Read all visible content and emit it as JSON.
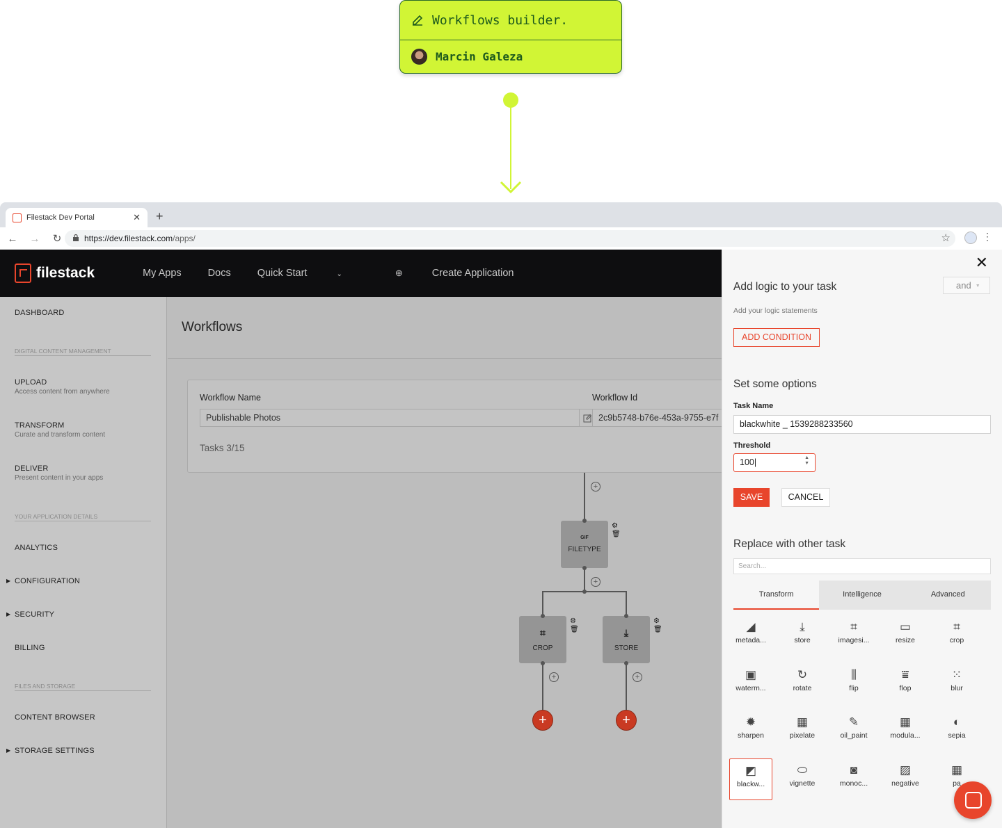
{
  "card": {
    "title": "Workflows builder.",
    "author": "Marcin Galeza",
    "accent": "#d1f535"
  },
  "browser": {
    "tab_title": "Filestack Dev Portal",
    "url_host": "https://dev.filestack.com",
    "url_path": "/apps/"
  },
  "nav": {
    "brand": "filestack",
    "links": [
      "My Apps",
      "Docs",
      "Quick Start",
      "Create Application"
    ]
  },
  "sidebar": {
    "dashboard": "DASHBOARD",
    "section_dcm": "DIGITAL CONTENT MANAGEMENT",
    "upload": "UPLOAD",
    "upload_sub": "Access content from anywhere",
    "transform": "TRANSFORM",
    "transform_sub": "Curate and transform content",
    "deliver": "DELIVER",
    "deliver_sub": "Present content in your apps",
    "section_app": "YOUR APPLICATION DETAILS",
    "analytics": "ANALYTICS",
    "configuration": "CONFIGURATION",
    "security": "SECURITY",
    "billing": "BILLING",
    "section_files": "FILES AND STORAGE",
    "content_browser": "CONTENT BROWSER",
    "storage_settings": "STORAGE SETTINGS"
  },
  "main": {
    "title": "Workflows",
    "workflow_name_label": "Workflow Name",
    "workflow_name_value": "Publishable Photos",
    "workflow_id_label": "Workflow Id",
    "workflow_id_value": "2c9b5748-b76e-453a-9755-e7f",
    "tasks": "Tasks 3/15",
    "nodes": {
      "filetype_icon": "GIF",
      "filetype": "FILETYPE",
      "crop": "CROP",
      "store": "STORE"
    }
  },
  "panel": {
    "logic_title": "Add logic to your task",
    "logic_select": "and",
    "logic_sub": "Add your logic statements",
    "add_condition": "ADD CONDITION",
    "options_title": "Set some options",
    "task_name_label": "Task Name",
    "task_name_value": "blackwhite _ 1539288233560",
    "threshold_label": "Threshold",
    "threshold_value": "100",
    "save": "SAVE",
    "cancel": "CANCEL",
    "replace_title": "Replace with other task",
    "search_placeholder": "Search...",
    "tabs": [
      "Transform",
      "Intelligence",
      "Advanced"
    ],
    "tasks": [
      {
        "label": "metada...",
        "icon": "metadata-icon"
      },
      {
        "label": "store",
        "icon": "store-icon"
      },
      {
        "label": "imagesi...",
        "icon": "imagesize-icon"
      },
      {
        "label": "resize",
        "icon": "resize-icon"
      },
      {
        "label": "crop",
        "icon": "crop-icon"
      },
      {
        "label": "waterm...",
        "icon": "watermark-icon"
      },
      {
        "label": "rotate",
        "icon": "rotate-icon"
      },
      {
        "label": "flip",
        "icon": "flip-icon"
      },
      {
        "label": "flop",
        "icon": "flop-icon"
      },
      {
        "label": "blur",
        "icon": "blur-icon"
      },
      {
        "label": "sharpen",
        "icon": "sharpen-icon"
      },
      {
        "label": "pixelate",
        "icon": "pixelate-icon"
      },
      {
        "label": "oil_paint",
        "icon": "oil-paint-icon"
      },
      {
        "label": "modula...",
        "icon": "modulate-icon"
      },
      {
        "label": "sepia",
        "icon": "sepia-icon"
      },
      {
        "label": "blackw...",
        "icon": "blackwhite-icon"
      },
      {
        "label": "vignette",
        "icon": "vignette-icon"
      },
      {
        "label": "monoc...",
        "icon": "monochrome-icon"
      },
      {
        "label": "negative",
        "icon": "negative-icon"
      },
      {
        "label": "pa",
        "icon": "partial-icon"
      }
    ]
  }
}
